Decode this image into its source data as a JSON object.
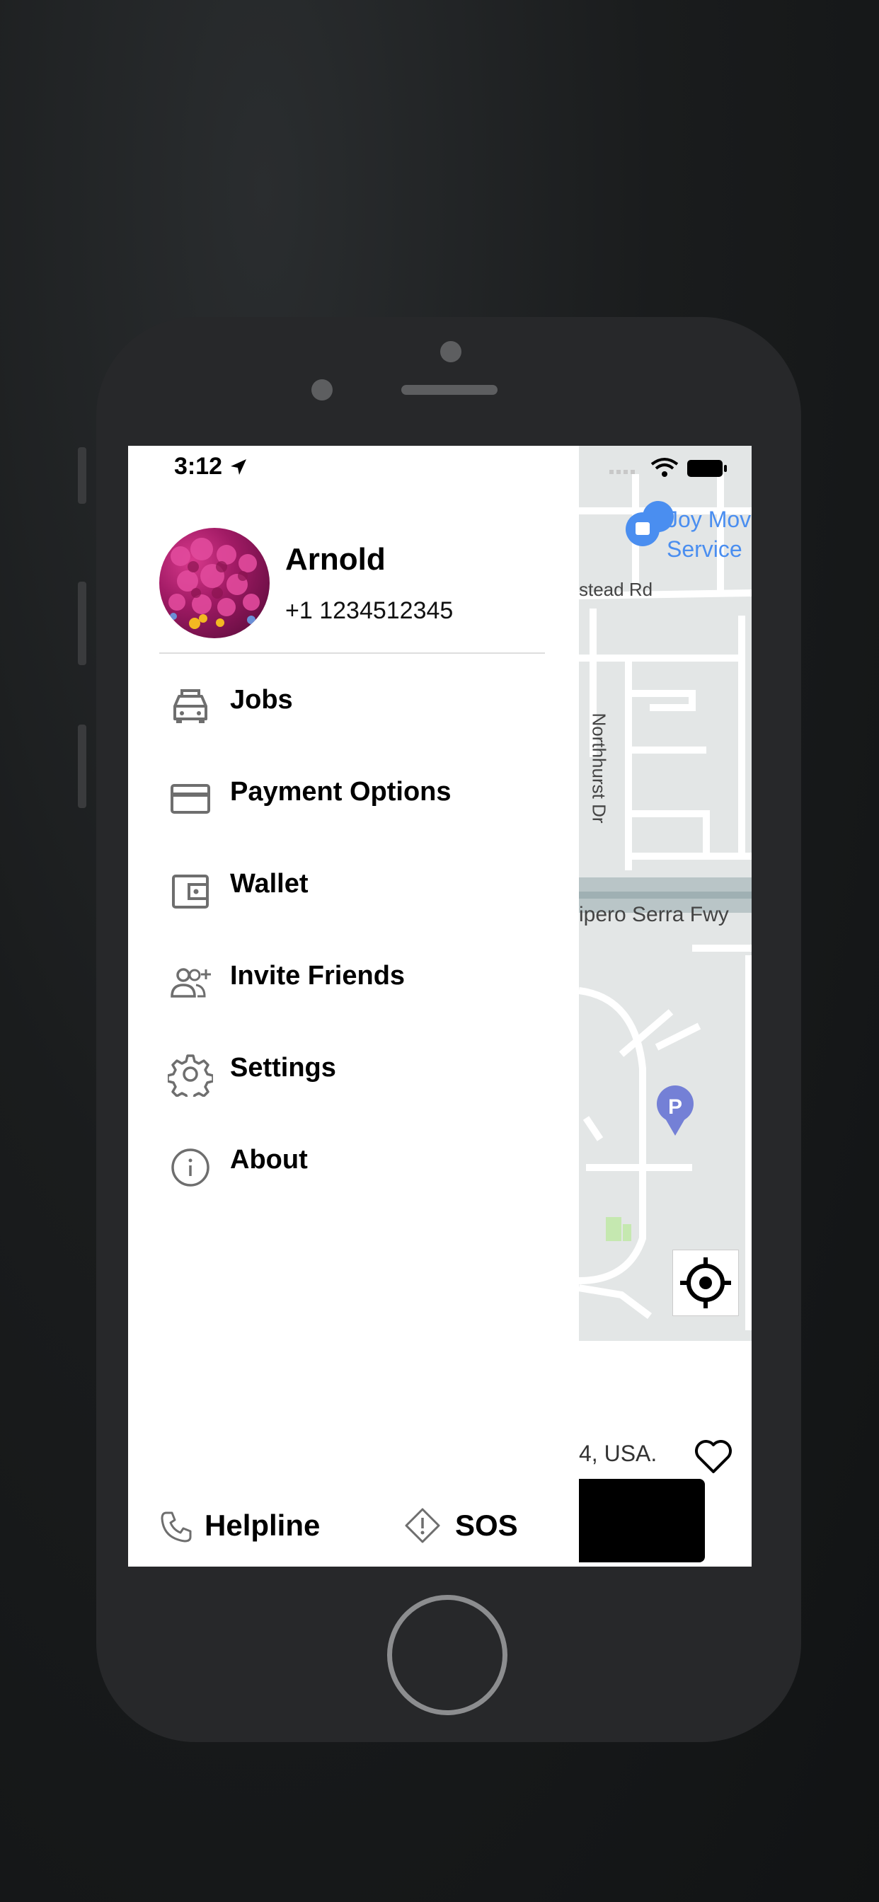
{
  "status_bar": {
    "time": "3:12"
  },
  "user": {
    "name": "Arnold",
    "phone": "+1 1234512345"
  },
  "menu": [
    {
      "label": "Jobs",
      "icon": "car-icon"
    },
    {
      "label": "Payment Options",
      "icon": "credit-card-icon"
    },
    {
      "label": "Wallet",
      "icon": "wallet-icon"
    },
    {
      "label": "Invite Friends",
      "icon": "add-user-icon"
    },
    {
      "label": "Settings",
      "icon": "gear-icon"
    },
    {
      "label": "About",
      "icon": "info-icon"
    }
  ],
  "footer": {
    "helpline": "Helpline",
    "sos": "SOS"
  },
  "map": {
    "place_label_1": "Joy Mov",
    "place_label_2": "Service",
    "road_1": "stead Rd",
    "road_2": "Northhurst Dr",
    "road_3": "ipero Serra Fwy"
  },
  "sheet": {
    "address_fragment": "4, USA."
  }
}
